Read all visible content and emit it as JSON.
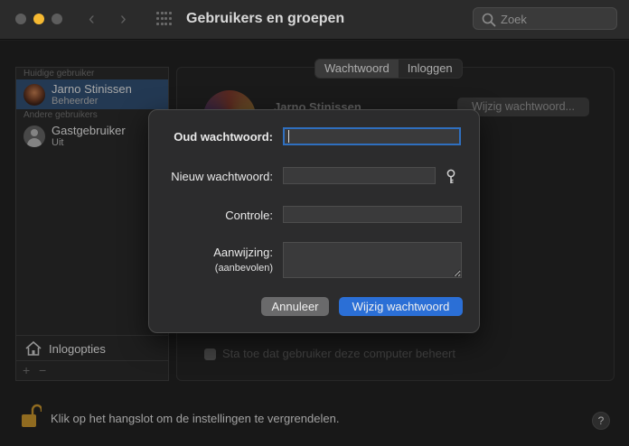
{
  "window": {
    "title": "Gebruikers en groepen",
    "search_placeholder": "Zoek"
  },
  "sidebar": {
    "section_current": "Huidige gebruiker",
    "section_other": "Andere gebruikers",
    "users": [
      {
        "name": "Jarno Stinissen",
        "role": "Beheerder",
        "selected": true
      },
      {
        "name": "Gastgebruiker",
        "role": "Uit",
        "selected": false
      }
    ],
    "login_options": "Inlogopties",
    "add": "+",
    "remove": "−"
  },
  "main": {
    "tabs": [
      "Wachtwoord",
      "Inloggen"
    ],
    "active_tab": "Wachtwoord",
    "user_name": "Jarno Stinissen",
    "change_password_button": "Wijzig wachtwoord...",
    "admin_checkbox_label": "Sta toe dat gebruiker deze computer beheert"
  },
  "footer": {
    "lock_text": "Klik op het hangslot om de instellingen te vergrendelen.",
    "help": "?"
  },
  "dialog": {
    "old_password_label": "Oud wachtwoord:",
    "new_password_label": "Nieuw wachtwoord:",
    "verify_label": "Controle:",
    "hint_label": "Aanwijzing:",
    "hint_sublabel": "(aanbevolen)",
    "cancel_button": "Annuleer",
    "confirm_button": "Wijzig wachtwoord"
  },
  "colors": {
    "accent": "#2b6fd6",
    "selection": "#2e4a6b",
    "minimize": "#f5b932"
  }
}
